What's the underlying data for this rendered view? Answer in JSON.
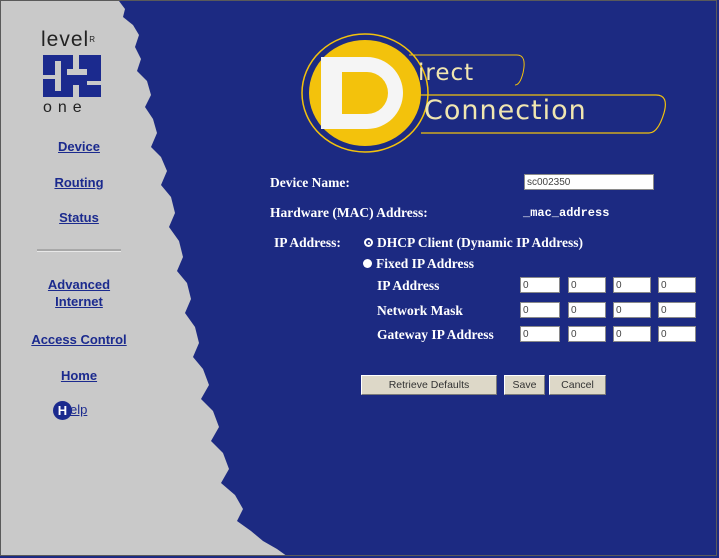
{
  "logo": {
    "top_text": "level",
    "mark": "R",
    "bottom_text": "one"
  },
  "nav": {
    "device": "Device",
    "routing": "Routing",
    "status": "Status",
    "advanced_internet_1": "Advanced",
    "advanced_internet_2": "Internet",
    "access_control": "Access Control",
    "home": "Home",
    "help_h": "H",
    "help_rest": "elp"
  },
  "brand": {
    "line1": "irect",
    "line2": "Connection"
  },
  "form": {
    "device_name_label": "Device Name:",
    "device_name_value": "sc002350",
    "mac_label": "Hardware (MAC) Address:",
    "mac_value": "_mac_address",
    "ip_label": "IP Address:",
    "dhcp_label": "DHCP Client (Dynamic IP Address)",
    "fixed_label": "Fixed IP Address",
    "ip_address_label": "IP Address",
    "netmask_label": "Network Mask",
    "gateway_label": "Gateway IP Address",
    "ip_octets": [
      "0",
      "0",
      "0",
      "0"
    ],
    "mask_octets": [
      "0",
      "0",
      "0",
      "0"
    ],
    "gw_octets": [
      "0",
      "0",
      "0",
      "0"
    ]
  },
  "buttons": {
    "retrieve": "Retrieve Defaults",
    "save": "Save",
    "cancel": "Cancel"
  },
  "colors": {
    "background": "#1c2a82",
    "sidebar": "#c9c9c9",
    "brand_yellow": "#f3c20c",
    "link": "#1b2a8e"
  }
}
